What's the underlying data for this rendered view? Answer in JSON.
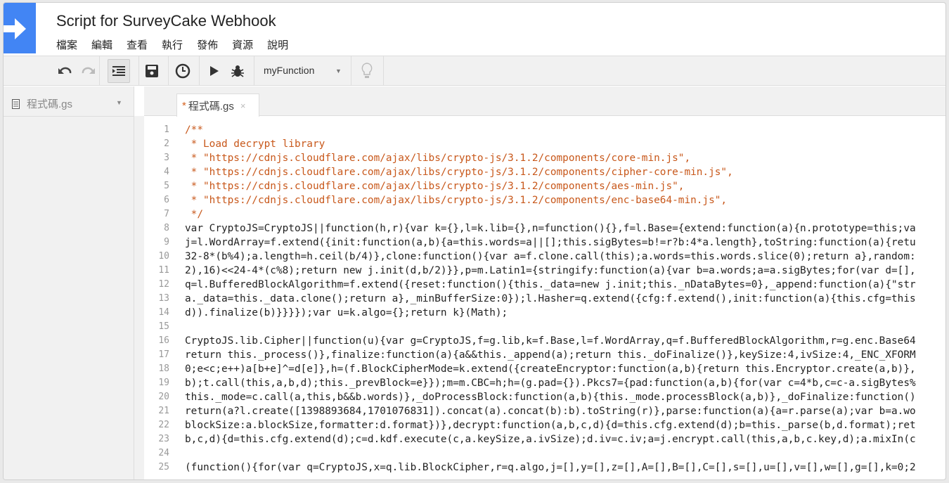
{
  "header": {
    "title": "Script for SurveyCake Webhook",
    "menu": [
      "檔案",
      "編輯",
      "查看",
      "執行",
      "發佈",
      "資源",
      "說明"
    ]
  },
  "toolbar": {
    "function_select": "myFunction",
    "icons": [
      "undo-icon",
      "redo-icon",
      "indent-icon",
      "save-icon",
      "triggers-icon",
      "run-icon",
      "debug-icon",
      "lightbulb-icon"
    ]
  },
  "sidebar": {
    "file": "程式碼.gs"
  },
  "tab": {
    "label": "程式碼.gs",
    "modified_marker": "*",
    "close": "×"
  },
  "colors": {
    "accent": "#4285f4",
    "comment": "#c8581b",
    "keyword": "#8b1e9e"
  },
  "code": [
    "/**",
    " * Load decrypt library",
    " * \"https://cdnjs.cloudflare.com/ajax/libs/crypto-js/3.1.2/components/core-min.js\",",
    " * \"https://cdnjs.cloudflare.com/ajax/libs/crypto-js/3.1.2/components/cipher-core-min.js\",",
    " * \"https://cdnjs.cloudflare.com/ajax/libs/crypto-js/3.1.2/components/aes-min.js\",",
    " * \"https://cdnjs.cloudflare.com/ajax/libs/crypto-js/3.1.2/components/enc-base64-min.js\",",
    " */",
    "var CryptoJS=CryptoJS||function(h,r){var k={},l=k.lib={},n=function(){},f=l.Base={extend:function(a){n.prototype=this;va",
    "j=l.WordArray=f.extend({init:function(a,b){a=this.words=a||[];this.sigBytes=b!=r?b:4*a.length},toString:function(a){retu",
    "32-8*(b%4);a.length=h.ceil(b/4)},clone:function(){var a=f.clone.call(this);a.words=this.words.slice(0);return a},random:",
    "2),16)<<24-4*(c%8);return new j.init(d,b/2)}},p=m.Latin1={stringify:function(a){var b=a.words;a=a.sigBytes;for(var d=[],",
    "q=l.BufferedBlockAlgorithm=f.extend({reset:function(){this._data=new j.init;this._nDataBytes=0},_append:function(a){\"str",
    "a._data=this._data.clone();return a},_minBufferSize:0});l.Hasher=q.extend({cfg:f.extend(),init:function(a){this.cfg=this",
    "d)).finalize(b)}}}});var u=k.algo={};return k}(Math);",
    "",
    "CryptoJS.lib.Cipher||function(u){var g=CryptoJS,f=g.lib,k=f.Base,l=f.WordArray,q=f.BufferedBlockAlgorithm,r=g.enc.Base64",
    "return this._process()},finalize:function(a){a&&this._append(a);return this._doFinalize()},keySize:4,ivSize:4,_ENC_XFORM",
    "0;e<c;e++)a[b+e]^=d[e]},h=(f.BlockCipherMode=k.extend({createEncryptor:function(a,b){return this.Encryptor.create(a,b)},",
    "b);t.call(this,a,b,d);this._prevBlock=e}});m=m.CBC=h;h=(g.pad={}).Pkcs7={pad:function(a,b){for(var c=4*b,c=c-a.sigBytes%",
    "this._mode=c.call(a,this,b&&b.words)},_doProcessBlock:function(a,b){this._mode.processBlock(a,b)},_doFinalize:function()",
    "return(a?l.create([1398893684,1701076831]).concat(a).concat(b):b).toString(r)},parse:function(a){a=r.parse(a);var b=a.wo",
    "blockSize:a.blockSize,formatter:d.format})},decrypt:function(a,b,c,d){d=this.cfg.extend(d);b=this._parse(b,d.format);ret",
    "b,c,d){d=this.cfg.extend(d);c=d.kdf.execute(c,a.keySize,a.ivSize);d.iv=c.iv;a=j.encrypt.call(this,a,b,c.key,d);a.mixIn(c",
    "",
    "(function(){for(var q=CryptoJS,x=q.lib.BlockCipher,r=q.algo,j=[],y=[],z=[],A=[],B=[],C=[],s=[],u=[],v=[],w=[],g=[],k=0;2"
  ]
}
